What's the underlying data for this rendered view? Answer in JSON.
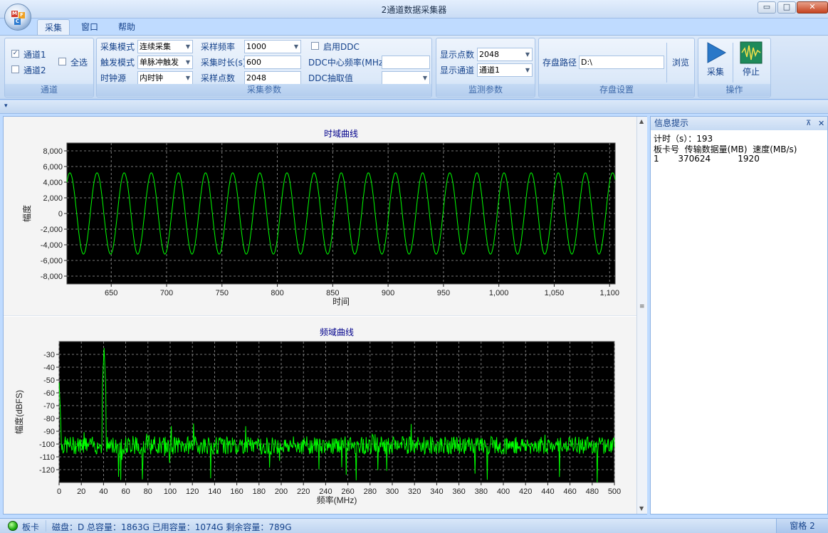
{
  "window": {
    "title": "2通道数据采集器",
    "minimize": "▭",
    "maximize": "□",
    "close": "✕"
  },
  "orb": {
    "tiles": [
      "M",
      "F",
      "C"
    ]
  },
  "tabs": [
    {
      "label": "采集",
      "active": true
    },
    {
      "label": "窗口"
    },
    {
      "label": "帮助"
    }
  ],
  "ribbon": {
    "channel": {
      "label": "通道",
      "ch1": "通道1",
      "ch1_checked": true,
      "ch2": "通道2",
      "ch2_checked": false,
      "all": "全选",
      "all_checked": false
    },
    "acq": {
      "label": "采集参数",
      "mode_label": "采集模式",
      "mode_value": "连续采集",
      "trigger_label": "触发模式",
      "trigger_value": "单脉冲触发",
      "clock_label": "时钟源",
      "clock_value": "内时钟",
      "rate_label": "采样频率",
      "rate_value": "1000",
      "duration_label": "采集时长(s)",
      "duration_value": "600",
      "points_label": "采样点数",
      "points_value": "2048",
      "ddc_enable": "启用DDC",
      "ddc_freq_label": "DDC中心频率(MHz)",
      "ddc_freq_value": "",
      "ddc_dec_label": "DDC抽取值",
      "ddc_dec_value": ""
    },
    "monitor": {
      "label": "监测参数",
      "points_label": "显示点数",
      "points_value": "2048",
      "channel_label": "显示通道",
      "channel_value": "通道1"
    },
    "storage": {
      "label": "存盘设置",
      "path_label": "存盘路径",
      "path_value": "D:\\",
      "browse": "浏览"
    },
    "ops": {
      "label": "操作",
      "acquire": "采集",
      "stop": "停止"
    }
  },
  "qat": {
    "arrow": "▾"
  },
  "info": {
    "title": "信息提示",
    "pin": "⊼",
    "close": "✕",
    "timer": "计时（s）：193",
    "header": "板卡号  传输数据量(MB)  速度(MB/s)",
    "row": "1       370624          1920"
  },
  "status": {
    "card": "板卡",
    "disk": "磁盘：D  总容量：1863G  已用容量：1074G  剩余容量：789G",
    "pane": "窗格 2"
  },
  "colors": {
    "trace": "#00ff00",
    "plot_bg": "#000000",
    "title_color": "#00008b"
  },
  "chart_data": [
    {
      "type": "line",
      "title": "时域曲线",
      "xlabel": "时间",
      "ylabel": "幅度",
      "xlim": [
        610,
        1105
      ],
      "ylim": [
        -9000,
        9000
      ],
      "x_ticks": [
        "650",
        "700",
        "750",
        "800",
        "850",
        "900",
        "950",
        "1,000",
        "1,050",
        "1,100"
      ],
      "x_tick_values": [
        650,
        700,
        750,
        800,
        850,
        900,
        950,
        1000,
        1050,
        1100
      ],
      "y_ticks": [
        "8,000",
        "6,000",
        "4,000",
        "2,000",
        "0",
        "-2,000",
        "-4,000",
        "-6,000",
        "-8,000"
      ],
      "y_tick_values": [
        8000,
        6000,
        4000,
        2000,
        0,
        -2000,
        -4000,
        -6000,
        -8000
      ],
      "grid": true,
      "series": [
        {
          "amplitude": 5200,
          "period": 24.5,
          "start_x": 610,
          "start_value": 4000
        }
      ]
    },
    {
      "type": "line",
      "title": "频域曲线",
      "xlabel": "频率(MHz)",
      "ylabel": "幅度(dBFS)",
      "xlim": [
        0,
        500
      ],
      "ylim": [
        -130,
        -20
      ],
      "x_ticks": [
        "0",
        "20",
        "40",
        "60",
        "80",
        "100",
        "120",
        "140",
        "160",
        "180",
        "200",
        "220",
        "240",
        "260",
        "280",
        "300",
        "320",
        "340",
        "360",
        "380",
        "400",
        "420",
        "440",
        "460",
        "480",
        "500"
      ],
      "x_tick_values": [
        0,
        20,
        40,
        60,
        80,
        100,
        120,
        140,
        160,
        180,
        200,
        220,
        240,
        260,
        280,
        300,
        320,
        340,
        360,
        380,
        400,
        420,
        440,
        460,
        480,
        500
      ],
      "y_ticks": [
        "-30",
        "-40",
        "-50",
        "-60",
        "-70",
        "-80",
        "-90",
        "-100",
        "-110",
        "-120"
      ],
      "y_tick_values": [
        -30,
        -40,
        -50,
        -60,
        -70,
        -80,
        -90,
        -100,
        -110,
        -120
      ],
      "grid": true,
      "noise_floor": -101,
      "peaks": [
        {
          "x": 0,
          "y": -52
        },
        {
          "x": 40.5,
          "y": -25
        },
        {
          "x": 81,
          "y": -93
        },
        {
          "x": 101,
          "y": -86
        },
        {
          "x": 121,
          "y": -84
        }
      ]
    }
  ]
}
